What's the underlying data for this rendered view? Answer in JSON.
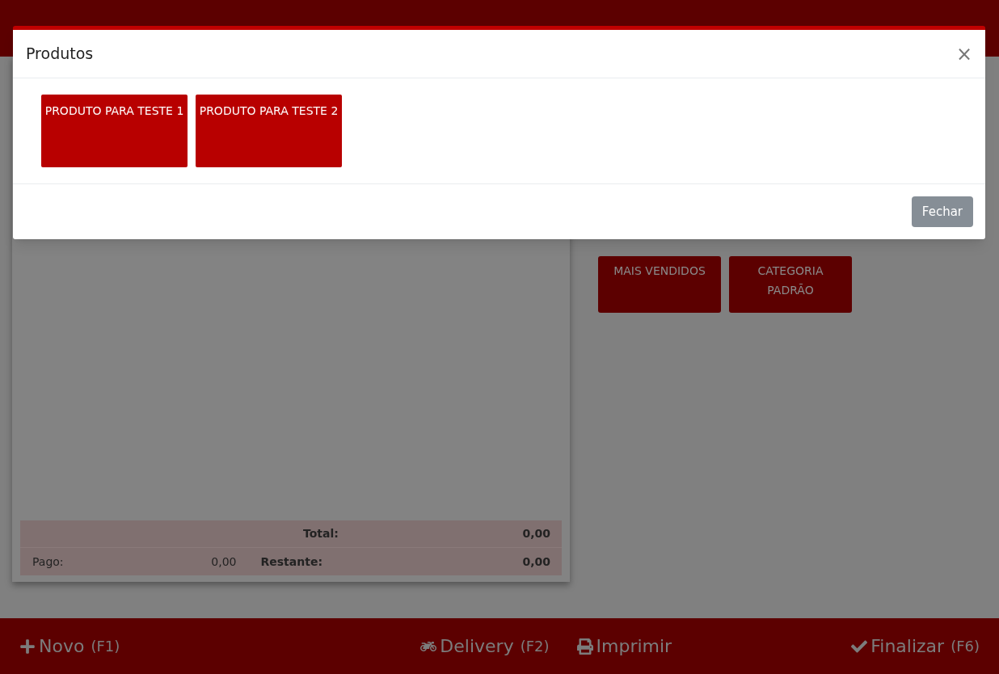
{
  "summary": {
    "total_label": "Total:",
    "total_value": "0,00",
    "paid_label": "Pago:",
    "paid_value": "0,00",
    "remaining_label": "Restante:",
    "remaining_value": "0,00"
  },
  "categories": [
    "MAIS VENDIDOS",
    "CATEGORIA PADRÃO"
  ],
  "footer": [
    {
      "label": "Novo",
      "key": "(F1)",
      "kind": "new"
    },
    {
      "label": "Delivery",
      "key": "(F2)",
      "kind": "delivery"
    },
    {
      "label": "Imprimir",
      "kind": "print"
    },
    {
      "label": "Finalizar",
      "key": "(F6)",
      "kind": "finish"
    }
  ],
  "modal": {
    "title": "Produtos",
    "close": "×",
    "products": [
      "PRODUTO PARA TESTE 1",
      "PRODUTO PARA TESTE 2"
    ],
    "button": "Fechar"
  }
}
